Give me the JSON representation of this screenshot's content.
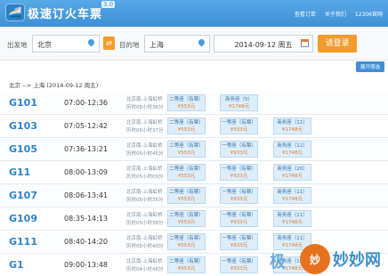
{
  "header": {
    "logo_text": "极速订火车票",
    "version": "3.0",
    "links": [
      "查看订单",
      "关于我们",
      "12306官网"
    ]
  },
  "search": {
    "from_label": "出发地",
    "from_value": "北京",
    "to_label": "目的地",
    "to_value": "上海",
    "date_value": "2014-09-12 周五",
    "login_label": "请登录",
    "swap_glyph": "⇄"
  },
  "filter_toggle": "展开筛选",
  "route_summary": "北京 --> 上海 (2014-09-12 周五)",
  "trains": [
    {
      "no": "G101",
      "time": "07:00-12:36",
      "st_a": "北京南-上海虹桥",
      "st_b": "历时05小时36分",
      "seats": [
        {
          "name": "二等座（有票）",
          "price": "¥553元"
        },
        {
          "name": "商务座（5）",
          "price": "¥1748元"
        },
        {
          "name": "",
          "price": ""
        }
      ]
    },
    {
      "no": "G103",
      "time": "07:05-12:42",
      "st_a": "北京南-上海虹桥",
      "st_b": "历时05小时37分",
      "seats": [
        {
          "name": "二等座（有票）",
          "price": "¥553元"
        },
        {
          "name": "一等座（有票）",
          "price": "¥933元"
        },
        {
          "name": "商务座（11）",
          "price": "¥1748元"
        }
      ]
    },
    {
      "no": "G105",
      "time": "07:36-13:21",
      "st_a": "北京南-上海虹桥",
      "st_b": "历时05小时45分",
      "seats": [
        {
          "name": "二等座（有票）",
          "price": "¥553元"
        },
        {
          "name": "一等座（有票）",
          "price": "¥933元"
        },
        {
          "name": "商务座（12）",
          "price": "¥1748元"
        }
      ]
    },
    {
      "no": "G11",
      "time": "08:00-13:09",
      "st_a": "北京南-上海虹桥",
      "st_b": "历时05小时09分",
      "seats": [
        {
          "name": "二等座（有票）",
          "price": "¥553元"
        },
        {
          "name": "一等座（有票）",
          "price": "¥933元"
        },
        {
          "name": "商务座（20）",
          "price": "¥1748元"
        }
      ]
    },
    {
      "no": "G107",
      "time": "08:06-13:41",
      "st_a": "北京南-上海虹桥",
      "st_b": "历时05小时35分",
      "seats": [
        {
          "name": "二等座（有票）",
          "price": "¥553元"
        },
        {
          "name": "一等座（有票）",
          "price": "¥933元"
        },
        {
          "name": "商务座（11）",
          "price": "¥1748元"
        }
      ]
    },
    {
      "no": "G109",
      "time": "08:35-14:13",
      "st_a": "北京南-上海虹桥",
      "st_b": "历时05小时38分",
      "seats": [
        {
          "name": "二等座（有票）",
          "price": "¥553元"
        },
        {
          "name": "一等座（有票）",
          "price": "¥933元"
        },
        {
          "name": "商务座（11）",
          "price": "¥1748元"
        }
      ]
    },
    {
      "no": "G111",
      "time": "08:40-14:20",
      "st_a": "北京南-上海虹桥",
      "st_b": "历时05小时40分",
      "seats": [
        {
          "name": "二等座（有票）",
          "price": "¥553元"
        },
        {
          "name": "一等座（有票）",
          "price": "¥933元"
        },
        {
          "name": "商务座（11）",
          "price": "¥1748元"
        }
      ]
    },
    {
      "no": "G1",
      "time": "09:00-13:48",
      "st_a": "北京南-上海虹桥",
      "st_b": "历时04小时48分",
      "seats": [
        {
          "name": "二等座（有票）",
          "price": "¥553元"
        },
        {
          "name": "一等座（有票）",
          "price": "¥933元"
        },
        {
          "name": "商务座（11）",
          "price": "¥1748元"
        }
      ]
    }
  ],
  "watermark": {
    "side": "极",
    "circle": "妙",
    "text": "妙妙网"
  }
}
